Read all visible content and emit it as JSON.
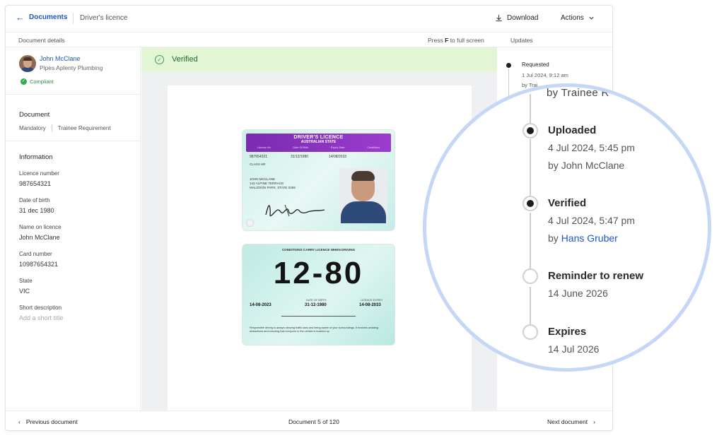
{
  "header": {
    "back_label": "Documents",
    "crumb": "Driver's licence",
    "download_label": "Download",
    "actions_label": "Actions"
  },
  "subbar": {
    "document_details": "Document details",
    "press_prefix": "Press",
    "press_key": "F",
    "press_suffix": "to full screen",
    "updates": "Updates"
  },
  "owner": {
    "name": "John McClane",
    "company": "Pipes Aplenty Plumbing",
    "status": "Compliant"
  },
  "document": {
    "heading": "Document",
    "tags": [
      "Mandatory",
      "Trainee Requirement"
    ]
  },
  "information": {
    "heading": "Information",
    "fields": [
      {
        "label": "Licence number",
        "value": "987654321"
      },
      {
        "label": "Date of birth",
        "value": "31 dec 1980"
      },
      {
        "label": "Name on licence",
        "value": "John McClane"
      },
      {
        "label": "Card number",
        "value": "10987654321"
      },
      {
        "label": "State",
        "value": "VIC"
      },
      {
        "label": "Short description",
        "value": "",
        "placeholder": "Add a short title"
      }
    ]
  },
  "banner": {
    "status": "Verified",
    "color": "#e2f6d6"
  },
  "card_front": {
    "title": "DRIVER'S LICENCE",
    "subtitle": "AUSTRALIAN STATE",
    "columns": [
      "Licence No",
      "Date Of Birth",
      "Expiry Date",
      "Conditions"
    ],
    "licence_no": "987654321",
    "dob": "31/12/1980",
    "expiry": "14/08/2033",
    "class": "CLASS HR",
    "name": "JOHN MCCLANE",
    "address1": "142 ALPINE TERRACE",
    "address2": "MALDOON PARK, STATE 0369"
  },
  "card_back": {
    "heading": "CONDITIONS CARRY LICENCE WHEN DRIVING",
    "big": "12-80",
    "left_value": "14-08-2023",
    "dob_label": "DATE OF BIRTH",
    "dob_value": "31-12-1980",
    "expiry_label": "LICENCE EXPIRY",
    "expiry_value": "14-08-2033",
    "fine_print": "Responsible driving is always obeying traffic laws and being aware of your surroundings. It involves avoiding distractions and ensuring that everyone in the vehicle is buckled up."
  },
  "timeline": {
    "first": {
      "title": "Requested",
      "date": "1 Jul 2024, 9:12 am",
      "by": "by Trai"
    },
    "zoom_cut": "by Trainee R"
  },
  "magnified": [
    {
      "title": "Uploaded",
      "date": "4 Jul 2024, 5:45 pm",
      "by_prefix": "by ",
      "by_name": "John McClane",
      "filled": true
    },
    {
      "title": "Verified",
      "date": "4 Jul 2024, 5:47 pm",
      "by_prefix": "by ",
      "by_name": "Hans Gruber",
      "filled": true
    },
    {
      "title": "Reminder to renew",
      "date": "14 June 2026",
      "filled": false
    },
    {
      "title": "Expires",
      "date": "14 Jul 2026",
      "filled": false
    }
  ],
  "footer": {
    "prev": "Previous document",
    "counter": "Document 5 of 120",
    "next": "Next document"
  },
  "colors": {
    "accent": "#1d58c9",
    "verified_text": "#1f6a2a",
    "compliant": "#2fae4c",
    "magnifier_ring": "#c5d6f6"
  },
  "icons": [
    "back-arrow-icon",
    "download-icon",
    "chevron-down-icon",
    "check-circle-icon",
    "chevron-left-icon",
    "chevron-right-icon"
  ]
}
